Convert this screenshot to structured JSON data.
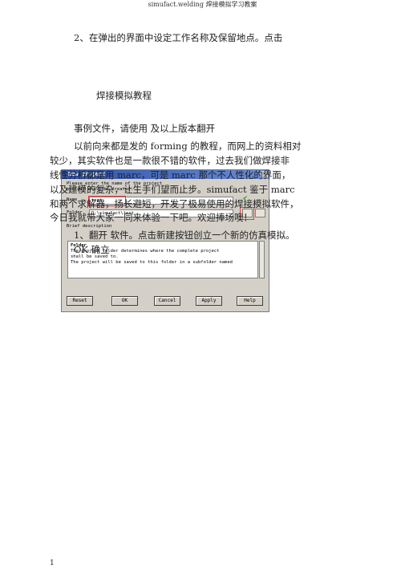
{
  "header": {
    "title": "simufact.welding 焊接模拟学习教案"
  },
  "body": {
    "step2": "2、在弹出的界面中设定工作名称及保留地点。点击",
    "title": "焊接模拟教程",
    "sample_files": "事例文件，请使用   及以上版本翻开",
    "intro_1": "以前向来都是发的 forming 的教程，而网上的资料相对",
    "intro_2": "较少，其实软件也是一款很不错的软件，过去我们做焊接非",
    "intro_3": "线性分析都是用 marc，可是 marc 那个不人性化的界面，",
    "intro_4": "以及建模的复杂，让生手们望而止步。simufact 鉴于 marc",
    "intro_5": "和两个求解器，扬长避短，开发了极易使用的焊接模拟软件，",
    "intro_6": "今日我就带大家一同来体验一下吧。欢迎捧场噢！",
    "step1": "1、翻开   软件。点击新建按钮创立一个新的仿真模拟。",
    "ok_confirm": "OK 确立"
  },
  "dialog": {
    "title": "New project",
    "hint_1": "Please enter the name of the project",
    "hint_2": "project shall be created:",
    "name_label": "Name",
    "name_value": "test",
    "folder_label": "Folder",
    "folder_value": "D:\\simufact\\test",
    "desc_label": "Brief description",
    "desc_heading": "Folder",
    "desc_1": "The project folder determines where the complete project",
    "desc_2": "shall be saved to.",
    "desc_3": "The project will be saved to this folder in a subfolder named",
    "buttons": [
      "Reset",
      "OK",
      "Cancel",
      "Apply",
      "Help"
    ]
  },
  "footer": {
    "page": "1"
  }
}
